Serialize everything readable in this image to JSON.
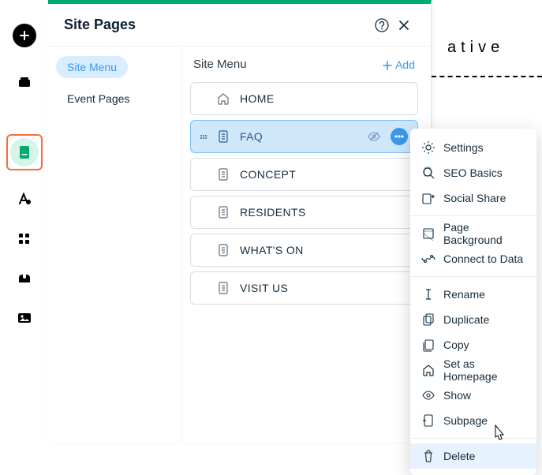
{
  "panel": {
    "title": "Site Pages",
    "subtitle": "Site Menu",
    "add_label": "Add"
  },
  "sidemenu": {
    "active": "Site Menu",
    "items": [
      "Event Pages"
    ]
  },
  "pages": [
    {
      "label": "HOME"
    },
    {
      "label": "FAQ",
      "selected": true
    },
    {
      "label": "CONCEPT"
    },
    {
      "label": "RESIDENTS"
    },
    {
      "label": "WHAT'S ON"
    },
    {
      "label": "VISIT US"
    }
  ],
  "context_menu": {
    "groups": [
      [
        "Settings",
        "SEO Basics",
        "Social Share"
      ],
      [
        "Page Background",
        "Connect to Data"
      ],
      [
        "Rename",
        "Duplicate",
        "Copy",
        "Set as Homepage",
        "Show",
        "Subpage"
      ],
      [
        "Delete"
      ]
    ],
    "highlighted": "Delete"
  },
  "background": {
    "title_fragment": "ative"
  },
  "icons": {
    "rail": [
      "add-icon",
      "layers-icon",
      "pages-icon",
      "font-icon",
      "apps-icon",
      "plugin-icon",
      "media-icon"
    ],
    "page_default": "page-icon",
    "page_home": "home-outline-icon",
    "ctx": {
      "Settings": "gear-icon",
      "SEO Basics": "seo-icon",
      "Social Share": "share-icon",
      "Page Background": "page-bg-icon",
      "Connect to Data": "connect-icon",
      "Rename": "rename-icon",
      "Duplicate": "duplicate-icon",
      "Copy": "copy-icon",
      "Set as Homepage": "home-outline-icon",
      "Show": "eye-icon",
      "Subpage": "subpage-icon",
      "Delete": "trash-icon"
    }
  },
  "colors": {
    "accent": "#3899ec",
    "brand": "#00a876"
  }
}
